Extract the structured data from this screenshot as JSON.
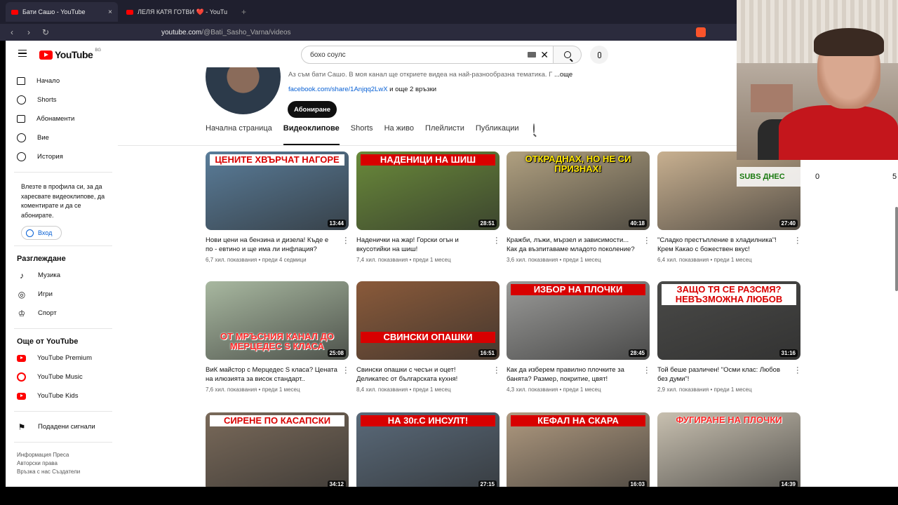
{
  "browser": {
    "tabs": [
      {
        "title": "Бати Сашо - YouTube",
        "active": true
      },
      {
        "title": "ЛЕЛЯ КАТЯ ГОТВИ ❤️ - YouTube",
        "active": false
      }
    ],
    "close_glyph": "×",
    "new_tab_glyph": "+",
    "url_host": "youtube.com",
    "url_path": "/@Bati_Sasho_Varna/videos"
  },
  "masthead": {
    "logo_text": "YouTube",
    "country": "BG",
    "search_value": "бохо соулс",
    "clear_glyph": "✕"
  },
  "sidebar": {
    "main": [
      {
        "label": "Начало",
        "icon": "home-icon"
      },
      {
        "label": "Shorts",
        "icon": "shorts-icon"
      },
      {
        "label": "Абонаменти",
        "icon": "subscriptions-icon"
      },
      {
        "label": "Вие",
        "icon": "you-icon"
      },
      {
        "label": "История",
        "icon": "history-icon"
      }
    ],
    "signin_text": "Влезте в профила си, за да харесвате видеоклипове, да коментирате и да се абонирате.",
    "signin_button": "Вход",
    "explore_heading": "Разглеждане",
    "explore": [
      {
        "label": "Музика",
        "icon": "music-icon",
        "glyph": "♪"
      },
      {
        "label": "Игри",
        "icon": "gaming-icon",
        "glyph": "◎"
      },
      {
        "label": "Спорт",
        "icon": "trophy-icon",
        "glyph": "♔"
      }
    ],
    "more_heading": "Още от YouTube",
    "more": [
      {
        "label": "YouTube Premium"
      },
      {
        "label": "YouTube Music"
      },
      {
        "label": "YouTube Kids"
      }
    ],
    "report": "Подадени сигнали",
    "report_glyph": "⚑",
    "footer": [
      "Информация  Преса",
      "Авторски права",
      "Връзка с нас  Създатели"
    ]
  },
  "channel": {
    "description": "Аз съм бати Сашо. В моя канал ще откриете видеа на най-разнообразна тематика. Г",
    "more": "...още",
    "link": "facebook.com/share/1Anjqq2LwX",
    "link_suffix": " и още 2 връзки",
    "subscribe": "Абониране",
    "tabs": [
      "Начална страница",
      "Видеоклипове",
      "Shorts",
      "На живо",
      "Плейлисти",
      "Публикации"
    ],
    "active_tab": 1
  },
  "videos": [
    {
      "thumb_text": "ЦЕНИТЕ ХВЪРЧАТ НАГОРЕ",
      "duration": "13:44",
      "title": "Нови цени на бензина и дизела! Къде е по - евтино и ще има ли инфлация?",
      "meta": "6,7 хил. показвания • преди 4 седмици",
      "bg": "#5a7d9a"
    },
    {
      "thumb_text": "НАДЕНИЦИ НА ШИШ",
      "duration": "28:51",
      "title": "Наденички на жар! Горски огън и вкусотийки на шиш!",
      "meta": "7,4 хил. показвания • преди 1 месец",
      "bg": "#6a8a3a"
    },
    {
      "thumb_text": "ОТКРАДНАХ, НО НЕ СИ ПРИЗНАХ!",
      "duration": "40:18",
      "title": "Кражби, лъжи, мързел и зависимости... Как да възпитаваме младото поколение?",
      "meta": "3,6 хил. показвания • преди 1 месец",
      "bg": "#b0a080"
    },
    {
      "thumb_text": "",
      "duration": "27:40",
      "title": "\"Сладко престъпление в хладилника\"! Крем Какао с божествен вкус!",
      "meta": "6,4 хил. показвания • преди 1 месец",
      "bg": "#c8b090"
    },
    {
      "thumb_text": "ОТ МРЪСНИЯ КАНАЛ ДО МЕРЦЕДЕС S КЛАСА",
      "duration": "25:08",
      "title": "ВиК майстор с Мерцедес S класа? Цената на илюзията за висок стандарт..",
      "meta": "7,6 хил. показвания • преди 1 месец",
      "bg": "#a8b8a0"
    },
    {
      "thumb_text": "СВИНСКИ ОПАШКИ",
      "duration": "16:51",
      "title": "Свински опашки с чесън и оцет! Деликатес от българската кухня!",
      "meta": "8,4 хил. показвания • преди 1 месец",
      "bg": "#8a5a3a"
    },
    {
      "thumb_text": "ИЗБОР НА ПЛОЧКИ",
      "duration": "28:45",
      "title": "Как да изберем правилно плочките за банята? Размер, покритие, цвят!",
      "meta": "4,3 хил. показвания • преди 1 месец",
      "bg": "#9a9a98"
    },
    {
      "thumb_text": "ЗАЩО ТЯ СЕ РАЗСМЯ? НЕВЪЗМОЖНА ЛЮБОВ",
      "duration": "31:16",
      "title": "Той беше различен! \"Осми клас: Любов без думи\"!",
      "meta": "2,9 хил. показвания • преди 1 месец",
      "bg": "#4a4a48"
    },
    {
      "thumb_text": "СИРЕНЕ ПО КАСАПСКИ",
      "duration": "34:12",
      "title": "",
      "meta": "",
      "bg": "#7a6a5a"
    },
    {
      "thumb_text": "НА 30г.С ИНСУЛТ!",
      "duration": "27:15",
      "title": "",
      "meta": "",
      "bg": "#5a6a7a"
    },
    {
      "thumb_text": "КЕФАЛ НА СКАРА",
      "duration": "16:03",
      "title": "",
      "meta": "",
      "bg": "#b09a80"
    },
    {
      "thumb_text": "ФУГИРАНЕ НА ПЛОЧКИ",
      "duration": "14:39",
      "title": "",
      "meta": "",
      "bg": "#c8c0b0"
    }
  ],
  "overlay": {
    "subs_label": "SUBS ДНЕС",
    "subs_value": "0",
    "subs_value2": "5"
  }
}
